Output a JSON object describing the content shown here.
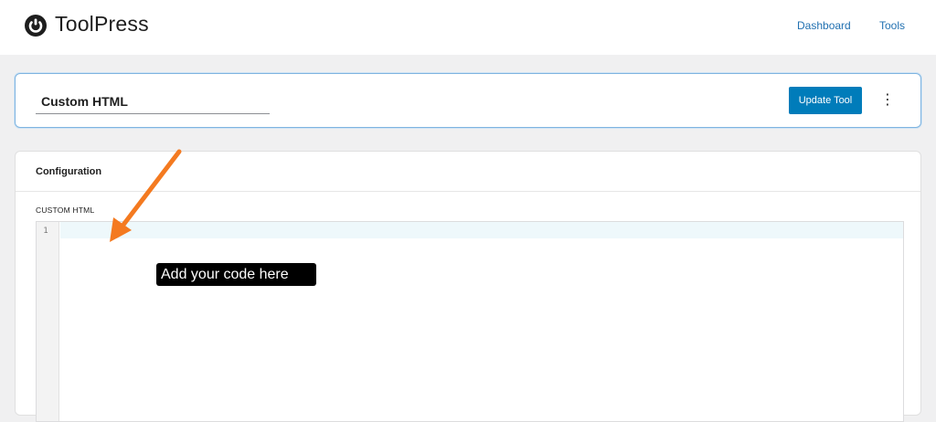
{
  "header": {
    "brand": "ToolPress",
    "nav": [
      {
        "label": "Dashboard"
      },
      {
        "label": "Tools"
      }
    ]
  },
  "title_bar": {
    "title_value": "Custom HTML",
    "update_label": "Update Tool",
    "more_icon": "⋮"
  },
  "config": {
    "heading": "Configuration",
    "field_label": "CUSTOM HTML",
    "editor": {
      "line_numbers": [
        "1"
      ],
      "content": ""
    }
  },
  "annotation": {
    "tooltip_text": "Add your code here",
    "arrow_color": "#f47a20"
  },
  "colors": {
    "accent": "#007cba",
    "link": "#2271b1"
  }
}
